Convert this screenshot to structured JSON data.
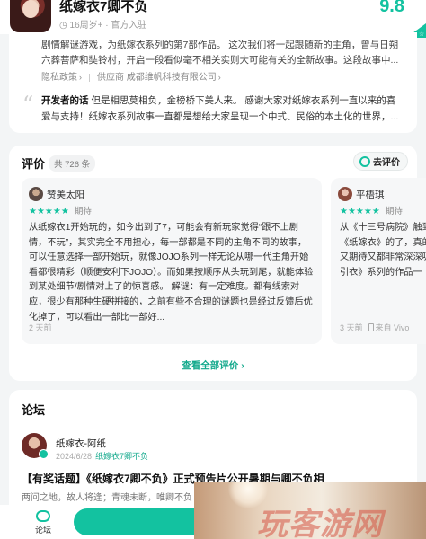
{
  "header": {
    "title": "纸嫁衣7卿不负",
    "meta": "16周岁+ · 官方入驻",
    "score": "9.8"
  },
  "info": {
    "description": "剧情解谜游戏，为纸嫁衣系列的第7部作品。 这次我们将一起跟随新的主角，曾与日朔六葬菩萨和奘铃村，开启一段看似毫不相关实则大可能有关的全新故事。这段故事中...",
    "privacy": "隐私政策",
    "provider": "供应商 成都维帆科技有限公司",
    "developer_label": "开发者的话",
    "developer_words": "但是相思莫相负，金榜桥下美人来。 感谢大家对纸嫁衣系列一直以来的喜爱与支持！纸嫁衣系列故事一直都是想给大家呈现一个中式、民俗的本土化的世界，..."
  },
  "reviews": {
    "title": "评价",
    "count": "共 726 条",
    "write_button": "去评价",
    "see_all": "查看全部评价 ›",
    "items": [
      {
        "name": "赞美太阳",
        "stars": "★★★★★",
        "star_label": "期待",
        "text": "从纸嫁衣1开始玩的，如今出到了7，可能会有新玩家觉得“跟不上剧情，不玩”，其实完全不用担心，每一部都是不同的主角不同的故事，可以任意选择一部开始玩，就像JOJO系列一样无论从哪一代主角开始看都很精彩（顺便安利下JOJO）。而如果按顺序从头玩到尾，就能体验到某处细节/剧情对上了的惊喜感。 解谜：有一定难度。都有线索对应，很少有那种生硬拼接的，之前有些不合理的谜题也是经过反馈后优化掉了，可以看出一部比一部好...",
        "time": "2 天前",
        "device": ""
      },
      {
        "name": "平梧琪",
        "stars": "★★★★★",
        "star_label": "期待",
        "text": "从《十三号病院》触到《纸嫁衣》的了，真的又期待又都非常深深吸引衣》系列的作品一",
        "time": "3 天前",
        "device": "来自 Vivo"
      }
    ]
  },
  "forum": {
    "title": "论坛",
    "post": {
      "author": "纸嫁衣-阿纸",
      "date": "2024/6/28",
      "tag": "纸嫁衣7卿不负",
      "title": "【有奖话题】《纸嫁衣7卿不负》正式预告片公开暑期与卿不负相"
    }
  },
  "bottom": {
    "forum_tab": "论坛",
    "snippet": "两问之地，故人将逢；青魂未断，唯卿不负"
  },
  "watermark": "玩客游网",
  "colors": {
    "accent": "#13c2a0",
    "link": "#13a98c"
  }
}
